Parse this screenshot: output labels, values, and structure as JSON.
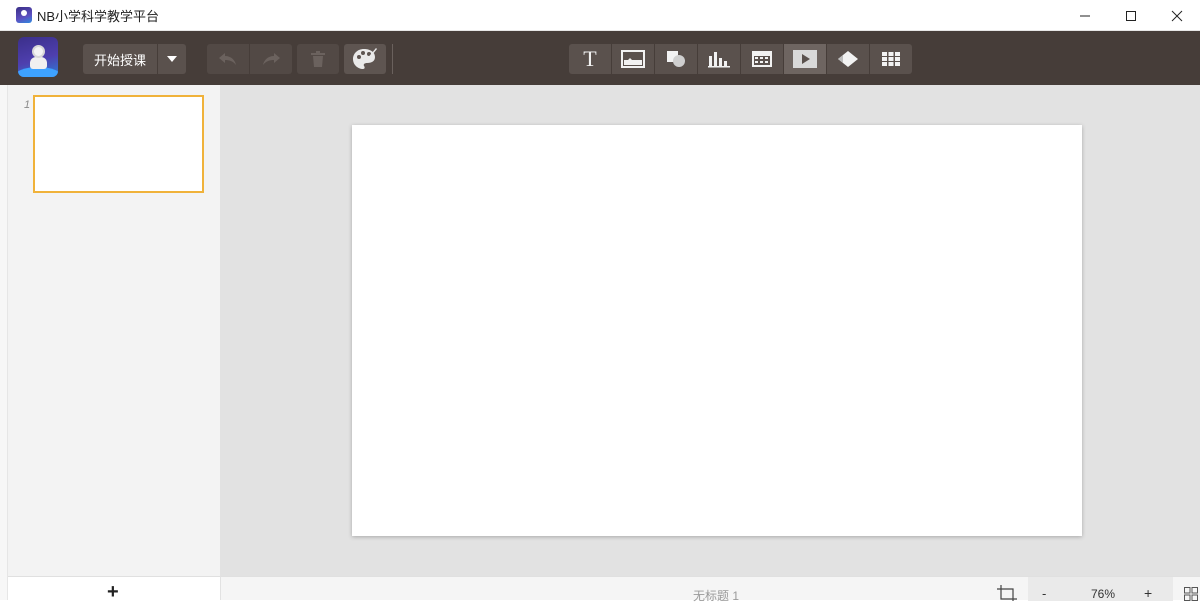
{
  "window": {
    "title": "NB小学科学教学平台",
    "controls": {
      "minimize": "—",
      "maximize": "☐",
      "close": "✕"
    }
  },
  "toolbar": {
    "start_label": "开始授课",
    "icons": {
      "logo": "astronaut-logo",
      "dropdown": "chevron-down-icon",
      "undo": "undo-icon",
      "redo": "redo-icon",
      "delete": "trash-icon",
      "theme": "palette-icon"
    },
    "insert_tools": [
      {
        "name": "text",
        "icon": "text-icon",
        "glyph": "T"
      },
      {
        "name": "image",
        "icon": "image-icon"
      },
      {
        "name": "shape",
        "icon": "shape-icon"
      },
      {
        "name": "chart",
        "icon": "chart-icon"
      },
      {
        "name": "media",
        "icon": "media-icon"
      },
      {
        "name": "video",
        "icon": "video-icon"
      },
      {
        "name": "eraser",
        "icon": "eraser-icon"
      },
      {
        "name": "table",
        "icon": "table-icon"
      }
    ],
    "colors": {
      "background": "#463d39",
      "button": "#5a514d",
      "accent": "#f0b23a"
    }
  },
  "slides": [
    {
      "number": "1",
      "selected": true
    }
  ],
  "bottom": {
    "add_slide": "+",
    "document_name": "无标题 1",
    "zoom_minus": "-",
    "zoom_level": "76%",
    "zoom_plus": "+"
  }
}
